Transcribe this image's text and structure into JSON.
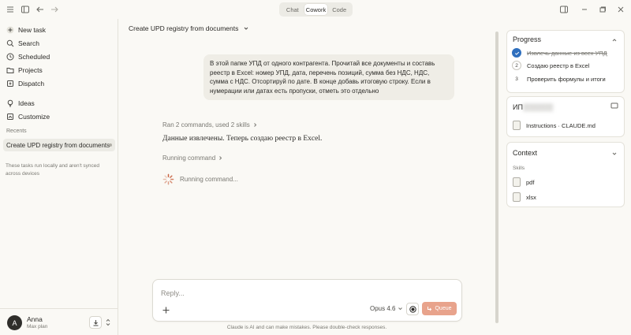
{
  "topbar": {
    "modes": [
      "Chat",
      "Cowork",
      "Code"
    ],
    "active_mode": "Cowork"
  },
  "sidebar": {
    "items": [
      {
        "label": "New task",
        "icon": "plus-icon"
      },
      {
        "label": "Search",
        "icon": "search-icon"
      },
      {
        "label": "Scheduled",
        "icon": "clock-icon"
      },
      {
        "label": "Projects",
        "icon": "folder-icon"
      },
      {
        "label": "Dispatch",
        "icon": "dispatch-icon"
      },
      {
        "label": "Ideas",
        "icon": "lightbulb-icon"
      },
      {
        "label": "Customize",
        "icon": "customize-icon"
      }
    ],
    "recents_label": "Recents",
    "recent_item": "Create UPD registry from documents",
    "local_note": "These tasks run locally and aren't synced across devices",
    "user": {
      "initial": "A",
      "name": "Anna",
      "plan": "Max plan"
    }
  },
  "main": {
    "title": "Create UPD registry from documents",
    "user_message": "В этой папке УПД от одного контрагента. Прочитай все документы и составь реестр в Excel: номер УПД, дата, перечень позиций, сумма без НДС, НДС, сумма с НДС. Отсортируй по дате. В конце добавь итоговую строку. Если в нумерации или датах есть пропуски, отметь это отдельно",
    "steps_summary": "Ran 2 commands, used 2 skills",
    "assistant_text": "Данные извлечены. Теперь создаю реестр в Excel.",
    "running_header": "Running command",
    "running_status": "Running command...",
    "reply": {
      "placeholder": "Reply...",
      "model": "Opus 4.6",
      "queue_label": "Queue",
      "queue_color": "#e8a38c"
    },
    "disclaimer": "Claude is AI and can make mistakes. Please double-check responses."
  },
  "right_panel": {
    "progress": {
      "title": "Progress",
      "steps": [
        {
          "label": "Извлечь данные из всех УПД",
          "status": "done"
        },
        {
          "label": "Создаю реестр в Excel",
          "status": "active",
          "num": "2"
        },
        {
          "label": "Проверить формулы и итоги",
          "status": "pending",
          "num": "3"
        }
      ],
      "done_color": "#2f6fbe"
    },
    "files": {
      "title_visible": "ИП",
      "file_label": "Instructions · CLAUDE.md"
    },
    "context": {
      "title": "Context",
      "skills_label": "Skills",
      "skills": [
        "pdf",
        "xlsx"
      ]
    }
  }
}
